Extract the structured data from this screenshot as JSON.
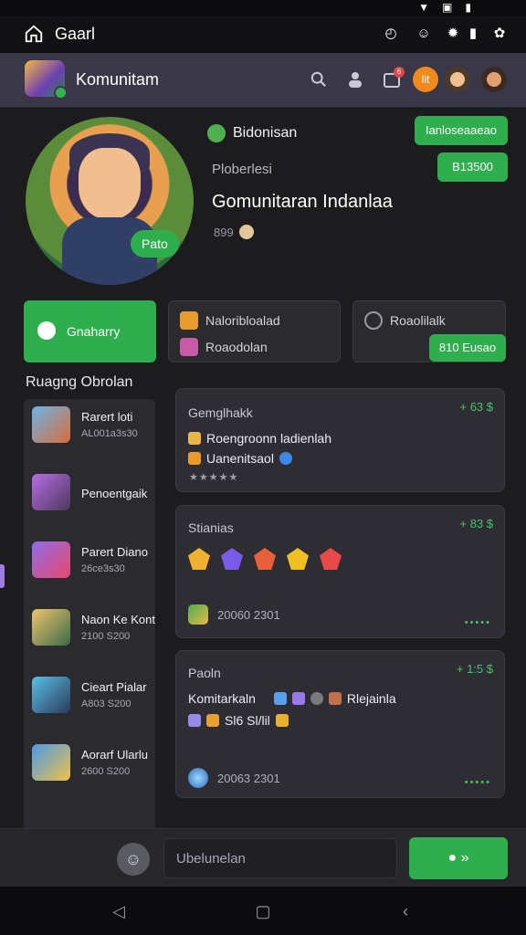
{
  "status_bar": {
    "icons": [
      "wifi-icon",
      "cast-icon",
      "battery-icon"
    ]
  },
  "topbar": {
    "title": "Gaarl",
    "icons": [
      "timer-icon",
      "smiley-icon",
      "bug-icon",
      "battery-icon",
      "settings-icon"
    ]
  },
  "header": {
    "app_title": "Komunitam",
    "notification_count": "6",
    "orange_badge": "lit",
    "icons": [
      "search-icon",
      "people-icon",
      "inbox-icon"
    ]
  },
  "profile": {
    "brand": "Bidonisan",
    "role": "Ploberlesi",
    "name": "Gomunitaran Indanlaa",
    "stat": "899",
    "avatar_pill": "Pato",
    "btn_primary": "Ianloseaaeao",
    "btn_secondary": "B13500"
  },
  "tabs": [
    {
      "label": "Gnaharry"
    },
    {
      "label_line1": "Naloribloalad",
      "label_line2": "Roaodolan"
    },
    {
      "label": "Roaolilalk",
      "button": "810 Eusao"
    }
  ],
  "section": {
    "title": "Ruagng Obrolan"
  },
  "chats": [
    {
      "name": "Rarert loti",
      "sub": "AL001a3s30"
    },
    {
      "name": "Penoentgaik",
      "sub": ""
    },
    {
      "name": "Parert Diano",
      "sub": "26ce3s30"
    },
    {
      "name": "Naon Ke Kont",
      "sub": "2100 S200"
    },
    {
      "name": "Cieart Pialar",
      "sub": "A803 S200"
    },
    {
      "name": "Aorarf Ularlu",
      "sub": "2600 S200"
    }
  ],
  "cards": [
    {
      "header": "Gemglhakk",
      "value": "+ 63 $",
      "line1": "Roengroonn ladienlah",
      "line2": "Uanenitsaol",
      "stars": "★★★★★"
    },
    {
      "header": "Stianias",
      "value": "+ 83 $",
      "foot": "20060 2301",
      "dots": "•••••"
    },
    {
      "header": "Paoln",
      "value": "+ 1:5 $",
      "line1a": "Komitarkaln",
      "line1b": "Rlejainla",
      "line2": "Sl6 Sl/lil",
      "foot": "20063 2301",
      "dots": "•••••"
    }
  ],
  "composer": {
    "placeholder": "Ubelunelan",
    "send_label": "●  »"
  },
  "colors": {
    "accent": "#2fae4e",
    "bg": "#1c1c1f",
    "card": "#2d2d33",
    "header": "#3a3748"
  }
}
